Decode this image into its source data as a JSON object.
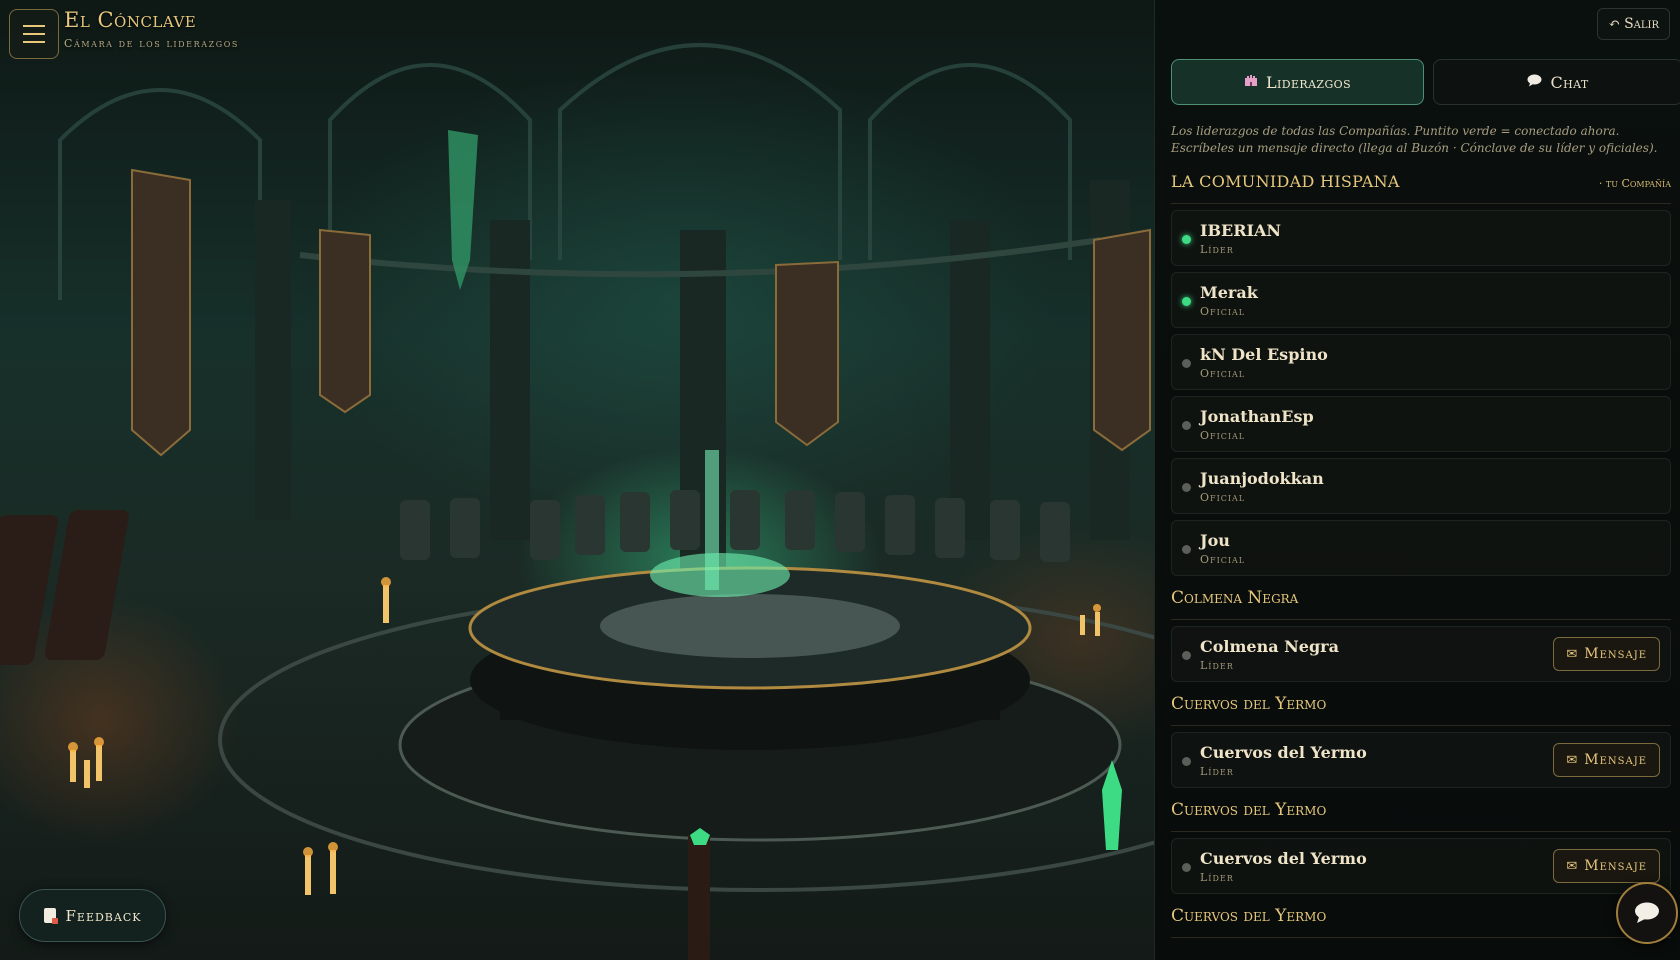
{
  "header": {
    "title": "El Cónclave",
    "subtitle": "Cámara de los liderazgos",
    "menu_icon": "hamburger-icon",
    "exit_label": "Salir",
    "exit_icon": "undo-arrow-icon"
  },
  "tabs": [
    {
      "label": "Liderazgos",
      "icon": "castle-icon",
      "active": true
    },
    {
      "label": "Chat",
      "icon": "speech-bubble-icon",
      "active": false
    }
  ],
  "info_text": "Los liderazgos de todas las Compañías. Puntito verde = conectado ahora. Escríbeles un mensaje directo (llega al Buzón · Cónclave de su líder y oficiales).",
  "groups": [
    {
      "title": "LA COMUNIDAD HISPANA",
      "tag": "· tu Compañía",
      "members": [
        {
          "name": "IBERIAN",
          "role": "Líder",
          "online": true
        },
        {
          "name": "Merak",
          "role": "Oficial",
          "online": true
        },
        {
          "name": "kN Del Espino",
          "role": "Oficial",
          "online": false
        },
        {
          "name": "JonathanEsp",
          "role": "Oficial",
          "online": false
        },
        {
          "name": "Juanjodokkan",
          "role": "Oficial",
          "online": false
        },
        {
          "name": "Jou",
          "role": "Oficial",
          "online": false
        }
      ]
    },
    {
      "title": "Colmena Negra",
      "members": [
        {
          "name": "Colmena Negra",
          "role": "Líder",
          "online": false,
          "action": "Mensaje"
        }
      ]
    },
    {
      "title": "Cuervos del Yermo",
      "members": [
        {
          "name": "Cuervos del Yermo",
          "role": "Líder",
          "online": false,
          "action": "Mensaje"
        }
      ]
    },
    {
      "title": "Cuervos del Yermo",
      "members": [
        {
          "name": "Cuervos del Yermo",
          "role": "Líder",
          "online": false,
          "action": "Mensaje"
        }
      ]
    },
    {
      "title": "Cuervos del Yermo",
      "members": []
    }
  ],
  "feedback_label": "Feedback",
  "chat_fab_icon": "chat-bubble-icon",
  "colors": {
    "gold": "#e6c77c",
    "online": "#3ddc84",
    "offline": "#5a5f5a",
    "active_tab": "#1b3e32"
  }
}
